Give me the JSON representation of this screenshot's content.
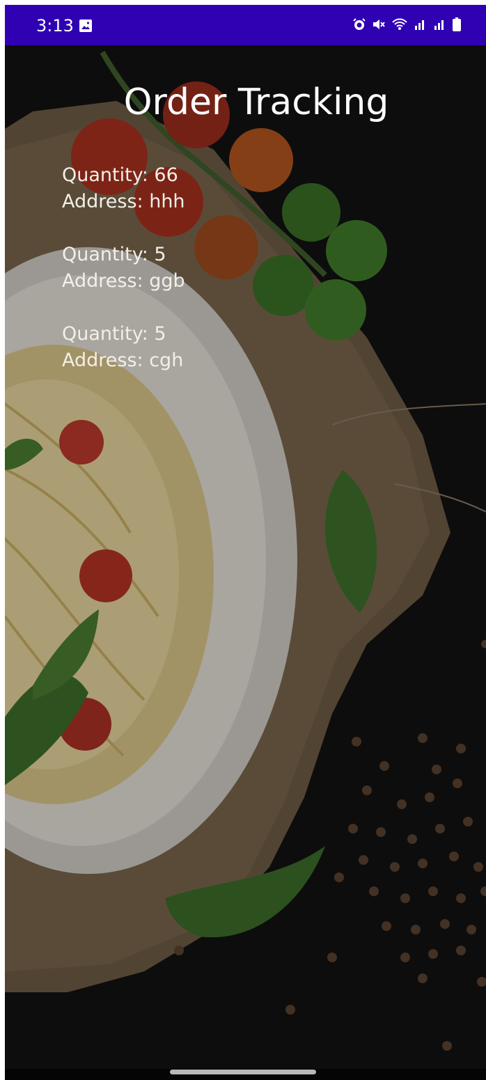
{
  "status_bar": {
    "time": "3:13",
    "icons": [
      "image-icon",
      "alarm-icon",
      "mute-icon",
      "wifi-icon",
      "signal-icon",
      "signal-icon",
      "battery-icon"
    ],
    "color": "#3000b3"
  },
  "page": {
    "title": "Order Tracking"
  },
  "orders": [
    {
      "quantity_label": "Quantity: 66",
      "address_label": "Address: hhh"
    },
    {
      "quantity_label": "Quantity: 5",
      "address_label": "Address: ggb"
    },
    {
      "quantity_label": "Quantity: 5",
      "address_label": "Address: cgh"
    }
  ],
  "colors": {
    "background": "#121212",
    "text": "#ffffff"
  }
}
